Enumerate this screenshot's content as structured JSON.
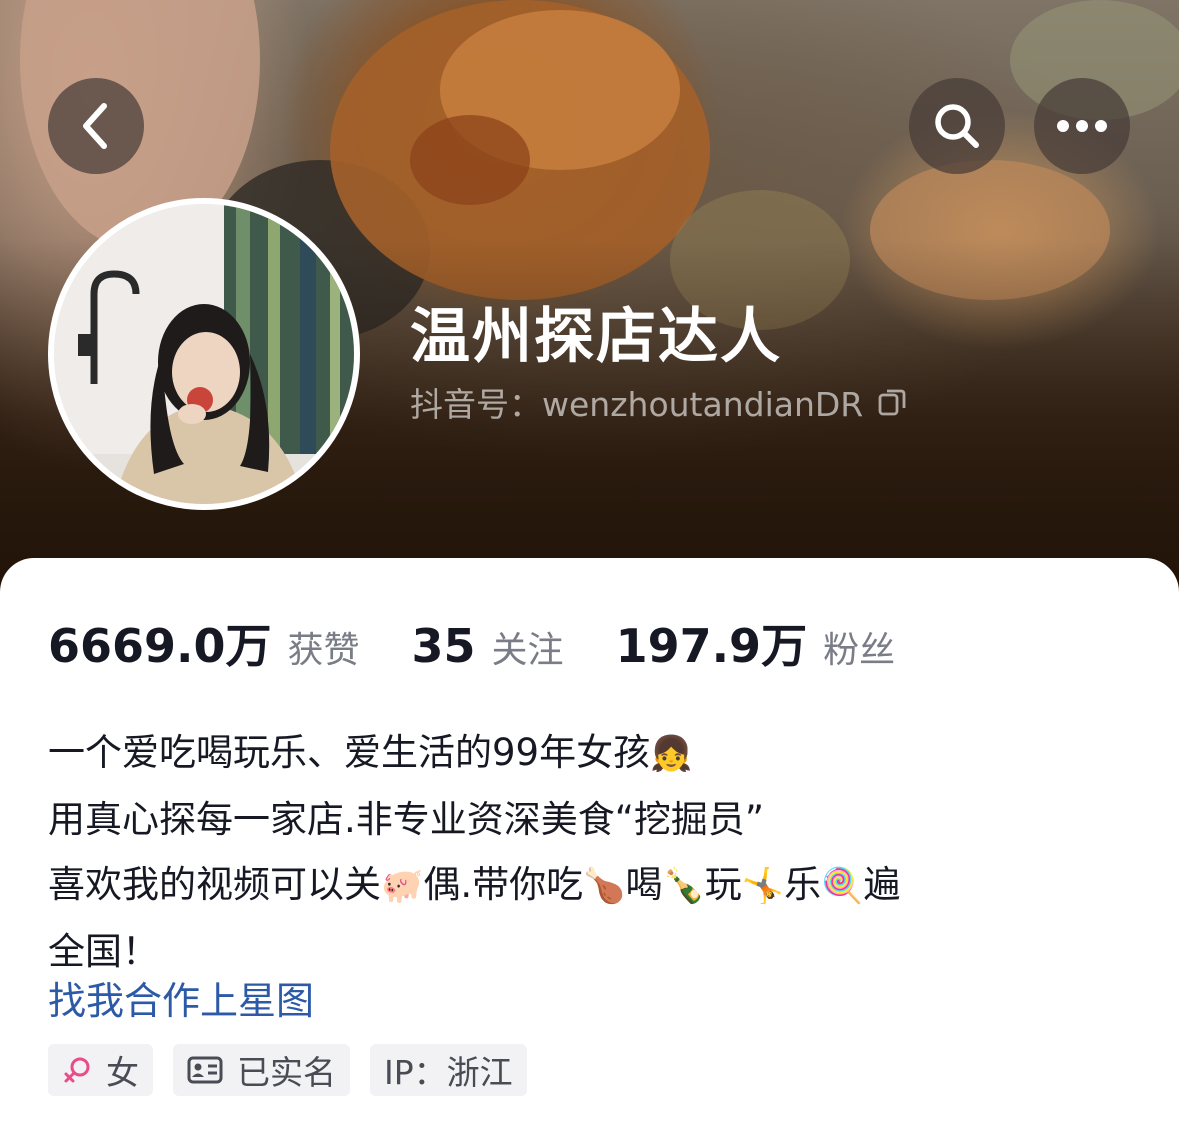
{
  "header": {
    "back_icon": "chevron-left-icon",
    "search_icon": "search-icon",
    "more_icon": "more-horizontal-icon"
  },
  "profile": {
    "nickname": "温州探店达人",
    "douyin_id": "抖音号：wenzhoutandianDR",
    "copy_icon": "copy-icon"
  },
  "stats": [
    {
      "value": "6669.0万",
      "label": "获赞"
    },
    {
      "value": "35",
      "label": "关注"
    },
    {
      "value": "197.9万",
      "label": "粉丝"
    }
  ],
  "bio": {
    "line1_text": "一个爱吃喝玩乐、爱生活的99年女孩",
    "line1_emoji": "👧",
    "line2": "用真心探每一家店.非专业资深美食“挖掘员”",
    "line3_a": "喜欢我的视频可以关",
    "line3_emoji1": "🐖",
    "line3_b": "偶.带你吃",
    "line3_emoji2": "🍗",
    "line3_c": "喝",
    "line3_emoji3": "🍾",
    "line3_d": "玩",
    "line3_emoji4": "🤸",
    "line3_e": "乐",
    "line3_emoji5": "🍭",
    "line3_f": "遍",
    "line4": "全国！"
  },
  "star_link": "找我合作上星图",
  "tags": [
    {
      "icon": "female-icon",
      "label": "女"
    },
    {
      "icon": "id-card-icon",
      "label": "已实名"
    },
    {
      "label": "IP：浙江"
    }
  ],
  "colors": {
    "link": "#2d5aa6",
    "text_primary": "#161823",
    "text_secondary": "#7a7c86",
    "tag_bg": "#f2f2f4",
    "female": "#e84d8a"
  }
}
